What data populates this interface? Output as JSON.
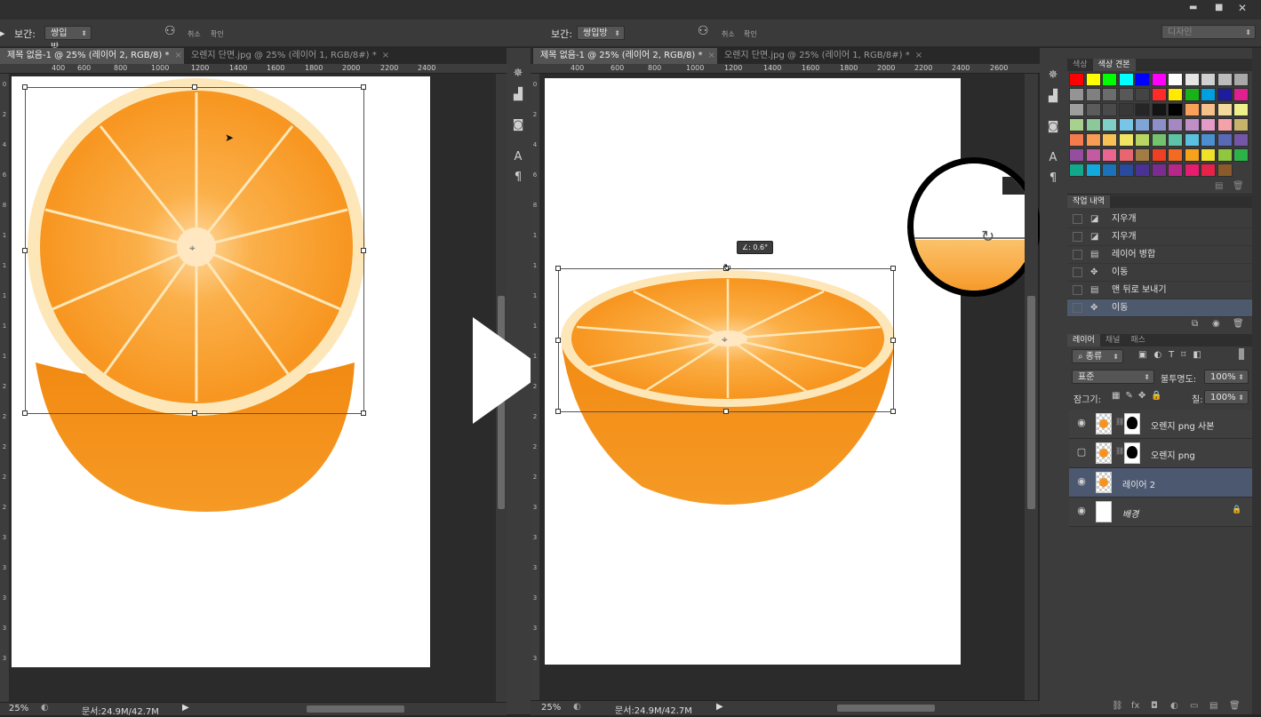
{
  "app": {
    "workspace": "디자인",
    "window_buttons": [
      "▬",
      "■",
      "✕"
    ]
  },
  "options_bar": {
    "interp_label": "보간:",
    "interp_value": "쌍입방",
    "cancel_label": "취소",
    "confirm_label": "확인"
  },
  "left_tabs": [
    {
      "label": "제목 없음-1 @ 25% (레이어 2, RGB/8) *"
    },
    {
      "label": "오렌지 단면.jpg @ 25% (레이어 1, RGB/8#) *"
    }
  ],
  "right_tabs": [
    {
      "label": "제목 없음-1 @ 25% (레이어 2, RGB/8) *"
    },
    {
      "label": "오렌지 단면.jpg @ 25% (레이어 1, RGB/8#) *"
    }
  ],
  "ruler_left": [
    "400",
    "600",
    "800",
    "1000",
    "1200",
    "1400",
    "1600",
    "1800",
    "2000",
    "2200"
  ],
  "ruler_right": [
    "400",
    "600",
    "800",
    "1000",
    "1200",
    "1400",
    "1600",
    "1800",
    "2000",
    "2200",
    "2400",
    "2600"
  ],
  "ruler_left_extra": "2400",
  "ruler_v_left": [
    "0",
    "2",
    "4",
    "6",
    "8",
    "1",
    "1",
    "1",
    "1",
    "1",
    "2",
    "2",
    "2",
    "2",
    "2",
    "3",
    "3",
    "3",
    "3",
    "3"
  ],
  "ruler_v_right": [
    "0",
    "2",
    "4",
    "6",
    "8",
    "1",
    "1",
    "1",
    "1",
    "1",
    "2",
    "2",
    "2",
    "2",
    "3",
    "3",
    "3",
    "3",
    "3",
    "3"
  ],
  "status": {
    "left_zoom": "25%",
    "left_doc": "문서:24.9M/42.7M",
    "right_zoom": "25%",
    "right_doc": "문서:24.9M/42.7M"
  },
  "rotation_tooltip": "∠: 0.6°",
  "swatches_panel": {
    "tabs": [
      "색상",
      "색상 견본"
    ],
    "active_tab": 1,
    "colors": [
      "#ff0000",
      "#ffff00",
      "#00ff00",
      "#00ffff",
      "#0000ff",
      "#ff00ff",
      "#ffffff",
      "#e6e6e6",
      "#d0d0d0",
      "#bcbcbc",
      "#a8a8a8",
      "#949494",
      "#808080",
      "#6c6c6c",
      "#585858",
      "#444444",
      "#ff2a2a",
      "#ffea00",
      "#18b318",
      "#00a0e0",
      "#1c1c9c",
      "#e0208f",
      "#9e9e9e",
      "#5c5c5c",
      "#4a4a4a",
      "#383838",
      "#262626",
      "#141414",
      "#000000",
      "#f9a05a",
      "#f6c08a",
      "#f4d99d",
      "#eef08c",
      "#a9d18e",
      "#8bc99a",
      "#7fcfc6",
      "#77c6e8",
      "#7fa4d6",
      "#8d8fc9",
      "#a587c2",
      "#c08fc6",
      "#e59bc8",
      "#f4a2a9",
      "#c8b36c",
      "#f47c4c",
      "#f79c52",
      "#f8c157",
      "#f0e463",
      "#b8d463",
      "#73c26e",
      "#5dc3a6",
      "#5bbfe0",
      "#4b8fce",
      "#5869b5",
      "#7356a6",
      "#954e9f",
      "#c45aa1",
      "#ea6691",
      "#e86670",
      "#a37b45",
      "#ef4023",
      "#f26b21",
      "#f7a21b",
      "#efe22b",
      "#8fc73e",
      "#2db24a",
      "#12a88c",
      "#12a9dc",
      "#1b72b8",
      "#2a4a9d",
      "#4a3292",
      "#7b2c8f",
      "#b7278a",
      "#e61c6e",
      "#e5234a",
      "#8a5a2a"
    ]
  },
  "history_panel": {
    "title": "작업 내역",
    "items": [
      {
        "label": "지우개",
        "icon": "eraser-icon"
      },
      {
        "label": "지우개",
        "icon": "eraser-icon"
      },
      {
        "label": "레이어 병합",
        "icon": "layer-icon"
      },
      {
        "label": "이동",
        "icon": "move-icon"
      },
      {
        "label": "맨 뒤로 보내기",
        "icon": "layer-icon"
      },
      {
        "label": "이동",
        "icon": "move-icon"
      }
    ]
  },
  "layers_panel": {
    "tabs": [
      "레이어",
      "채널",
      "패스"
    ],
    "active_tab": 0,
    "filter_label": "종류",
    "blend_mode": "표준",
    "opacity_label": "불투명도:",
    "opacity_value": "100%",
    "lock_label": "잠그기:",
    "fill_label": "칠:",
    "fill_value": "100%",
    "layers": [
      {
        "name": "오렌지 png 사본",
        "visible": true,
        "active": false,
        "mask": true,
        "italic": false
      },
      {
        "name": "오렌지 png",
        "visible": false,
        "active": false,
        "mask": true,
        "italic": false
      },
      {
        "name": "레이어 2",
        "visible": true,
        "active": true,
        "mask": false,
        "italic": false
      },
      {
        "name": "배경",
        "visible": true,
        "active": false,
        "mask": false,
        "italic": true
      }
    ],
    "bottom_icons": [
      "link-icon",
      "fx-icon",
      "mask-icon",
      "adjustment-icon",
      "folder-icon",
      "new-layer-icon",
      "trash-icon"
    ]
  },
  "colors": {
    "orange_peel": "#f7931e",
    "orange_flesh": "#fba93a",
    "orange_pith": "#fde8c2",
    "play_arrow": "#ffffff"
  }
}
